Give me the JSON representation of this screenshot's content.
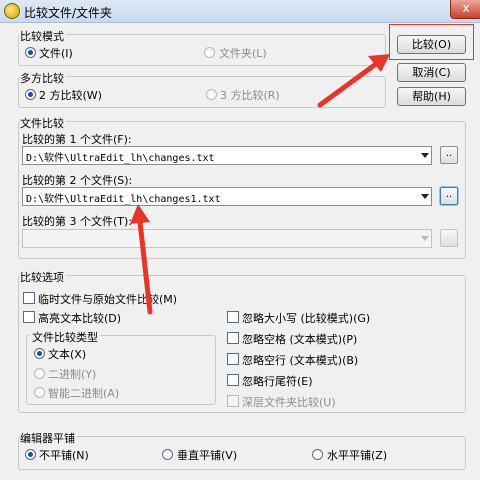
{
  "window": {
    "title": "比较文件/文件夹",
    "close_glyph": "x"
  },
  "compare_mode": {
    "label": "比较模式",
    "options": [
      "文件(I)",
      "文件夹(L)"
    ]
  },
  "multi_compare": {
    "label": "多方比较",
    "options": [
      "2 方比较(W)",
      "3 方比较(R)"
    ]
  },
  "buttons": {
    "compare": "比较(O)",
    "cancel": "取消(C)",
    "help": "帮助(H)"
  },
  "file_compare": {
    "label": "文件比较",
    "file1_label": "比较的第 1 个文件(F):",
    "file1_value": "D:\\软件\\UltraEdit_lh\\changes.txt",
    "file2_label": "比较的第 2 个文件(S):",
    "file2_value": "D:\\软件\\UltraEdit_lh\\changes1.txt",
    "file3_label": "比较的第 3 个文件(T):",
    "file3_value": "",
    "browse": ".."
  },
  "compare_options": {
    "label": "比较选项",
    "temp_vs_original": "临时文件与原始文件比较(M)",
    "advanced_text": "高亮文本比较(D)",
    "file_type": {
      "label": "文件比较类型",
      "options": [
        "文本(X)",
        "二进制(Y)",
        "智能二进制(A)"
      ]
    },
    "ignore_case": "忽略大小写 (比较模式)(G)",
    "ignore_spaces": "忽略空格 (文本模式)(P)",
    "ignore_blank_lines": "忽略空行 (文本模式)(B)",
    "ignore_line_endings": "忽略行尾符(E)",
    "deep_folder": "深层文件夹比较(U)"
  },
  "editor_tiling": {
    "label": "编辑器平铺",
    "options": [
      "不平铺(N)",
      "垂直平铺(V)",
      "水平平铺(Z)"
    ]
  },
  "colors": {
    "annotation": "#e8352c"
  }
}
